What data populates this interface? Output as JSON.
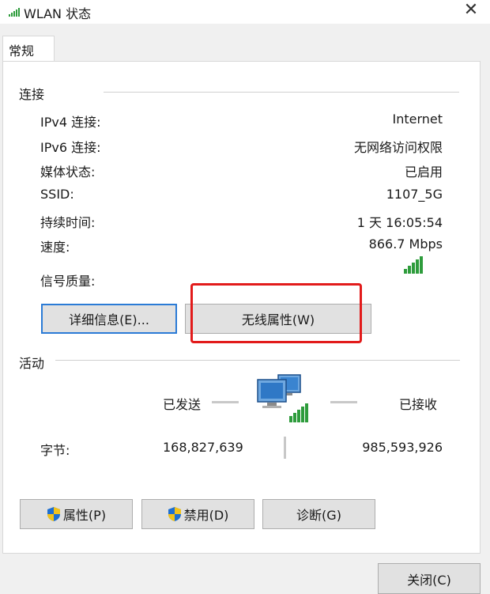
{
  "window": {
    "title": "WLAN 状态",
    "close_glyph": "✕"
  },
  "tabs": [
    {
      "label": "常规"
    }
  ],
  "connection": {
    "heading": "连接",
    "rows": [
      {
        "label": "IPv4 连接:",
        "value": "Internet"
      },
      {
        "label": "IPv6 连接:",
        "value": "无网络访问权限"
      },
      {
        "label": "媒体状态:",
        "value": "已启用"
      },
      {
        "label": "SSID:",
        "value": "1107_5G"
      },
      {
        "label": "持续时间:",
        "value": "1 天 16:05:54"
      },
      {
        "label": "速度:",
        "value": "866.7 Mbps"
      }
    ],
    "signal_label": "信号质量:",
    "signal_bars": 5,
    "details_button": "详细信息(E)...",
    "wireless_props_button": "无线属性(W)"
  },
  "activity": {
    "heading": "活动",
    "sent_label": "已发送",
    "received_label": "已接收",
    "bytes_label": "字节:",
    "bytes_sent": "168,827,639",
    "bytes_received": "985,593,926"
  },
  "actions": {
    "properties_button": "属性(P)",
    "disable_button": "禁用(D)",
    "diagnose_button": "诊断(G)"
  },
  "footer": {
    "close_button": "关闭(C)"
  },
  "colors": {
    "signal_green": "#2e9c3c",
    "highlight_red": "#e21b1b",
    "default_blue": "#2b7bd6",
    "shield_blue": "#1f6fd0",
    "shield_yellow": "#f2c21b"
  }
}
